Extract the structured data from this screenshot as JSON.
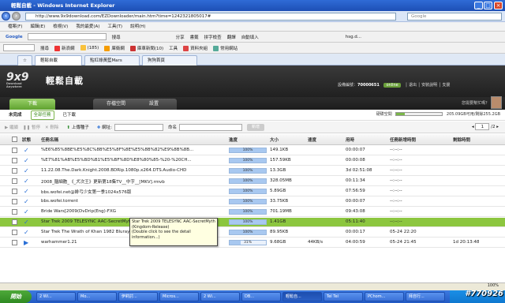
{
  "window": {
    "title": "輕鬆自載 - Windows Internet Explorer"
  },
  "address": {
    "url": "http://www.9x9download.com/EZDownloader/main.htm?time=1242321805017#",
    "search_placeholder": "Google"
  },
  "menu": [
    "檔案(F)",
    "編輯(E)",
    "檢視(V)",
    "我的最愛(A)",
    "工具(T)",
    "說明(H)"
  ],
  "google_bar": {
    "label": "Google",
    "items": [
      "搜尋",
      "分享",
      "書籤",
      "拼字檢查",
      "翻譯",
      "自動填入",
      "hsg.d..."
    ]
  },
  "links_bar": {
    "items": [
      "搜尋",
      "新浪網",
      "(185)",
      "庫衛網",
      "庫車新聞(10)",
      "工具",
      "資料夾組",
      "常用網站"
    ]
  },
  "browser_tabs": [
    "輕鬆自載",
    "點紅綠黃藍Mars",
    "狗狗首頁"
  ],
  "app": {
    "logo": "9x9",
    "logo_sub": "Download Anywhere",
    "title": "輕鬆自載",
    "user_label": "設備編號",
    "user_id": "70000651",
    "online": "online",
    "logout": "退出",
    "install": "安裝說明",
    "help": "支援",
    "greeting": "您需要幫忙嗎？",
    "tabs": [
      "下載",
      "存檔空間",
      "設置"
    ]
  },
  "subtabs": [
    "未完成",
    "全部任務",
    "已下載"
  ],
  "space": {
    "label": "硬碟空間",
    "text": "205.09GB可用/剩餘255.2GB",
    "used_pct": 19
  },
  "actions": {
    "pause_all": "繼續",
    "pause": "暫停",
    "delete": "刪除",
    "upload": "上傳種子",
    "add": "網址:",
    "name_label": "命名",
    "go": "新增"
  },
  "pager": {
    "page": "1",
    "total": "/2"
  },
  "columns": [
    "狀態",
    "任務名稱",
    "進度",
    "大小",
    "速度",
    "用時",
    "任務新增時間",
    "剩餘時間"
  ],
  "rows": [
    {
      "name": "%E6%85%8BE%E5%8C%8B%E5%8F%8E%E5%8B%82%E9%8B%8B...",
      "progress": 100,
      "size": "149.1KB",
      "speed": "",
      "time": "00:00:07",
      "added": "--:--:--",
      "remain": "",
      "status": "check"
    },
    {
      "name": "%E7%81%AB%E5%BD%B1%E5%BF%8D%E8%80%85-%20-%20CH...",
      "progress": 100,
      "size": "157.59KB",
      "speed": "",
      "time": "00:00:08",
      "added": "--:--:--",
      "remain": "",
      "status": "check"
    },
    {
      "name": "11.22.08.The.Dark.Knight.2008.BDRip.1080p.x264.DTS.Audio-CHD",
      "progress": 100,
      "size": "13.3GB",
      "speed": "",
      "time": "3d 02:51:08",
      "added": "--:--:--",
      "remain": "",
      "status": "check"
    },
    {
      "name": "2008_腦細胞_《_犬次王》更新第18集TV__中字__[MKV].rmvb",
      "progress": 100,
      "size": "328.05MB",
      "speed": "",
      "time": "00:11:34",
      "added": "--:--:--",
      "remain": "",
      "status": "check"
    },
    {
      "name": "bbs.wofei.net@緋弓少女第一季1024x576版",
      "progress": 100,
      "size": "5.89GB",
      "speed": "",
      "time": "07:56:59",
      "added": "--:--:--",
      "remain": "",
      "status": "check"
    },
    {
      "name": "bbs.wofei.torrent",
      "progress": 100,
      "size": "33.75KB",
      "speed": "",
      "time": "00:00:07",
      "added": "--:--:--",
      "remain": "",
      "status": "check"
    },
    {
      "name": "Bride Wars[2009(DvDrip(Eng)-FXG",
      "progress": 100,
      "size": "701.19MB",
      "speed": "",
      "time": "09:43:08",
      "added": "--:--:--",
      "remain": "",
      "status": "check"
    },
    {
      "name": "Star Trek 2009 TELESYNC AAC-SecretMyth (Kingdom-Release)",
      "progress": 100,
      "size": "1.41GB",
      "speed": "",
      "time": "05:11:40",
      "added": "--:--:--",
      "remain": "",
      "status": "check",
      "highlight": true
    },
    {
      "name": "Star Trek The Wrath of Khan 1982 Bluray...",
      "progress": 100,
      "size": "89.95KB",
      "speed": "",
      "time": "00:00:17",
      "added": "05-24 22:20",
      "remain": "",
      "status": "check"
    },
    {
      "name": "warhammer1.21",
      "progress": 31,
      "size": "9.68GB",
      "speed": "44KB/s",
      "time": "04:00:59",
      "added": "05-24 21:45",
      "remain": "1d 20:13:48",
      "status": "play"
    }
  ],
  "tooltip": {
    "line1": "Star Trek 2009 TELESYNC AAC-SecretMyth",
    "line2": "(Kingdom-Release)",
    "line3": "(Double click to see the detail information...)"
  },
  "statusbar": {
    "zoom": "100%"
  },
  "taskbar": {
    "start": "開始",
    "tasks": [
      "2 Wi...",
      "Mo...",
      "伊莉討...",
      "Micros...",
      "2 Wi...",
      "DB...",
      "輕鬆自...",
      "Tel Tel",
      "PChom...",
      "拜自行..."
    ],
    "watermark": "#770926"
  }
}
